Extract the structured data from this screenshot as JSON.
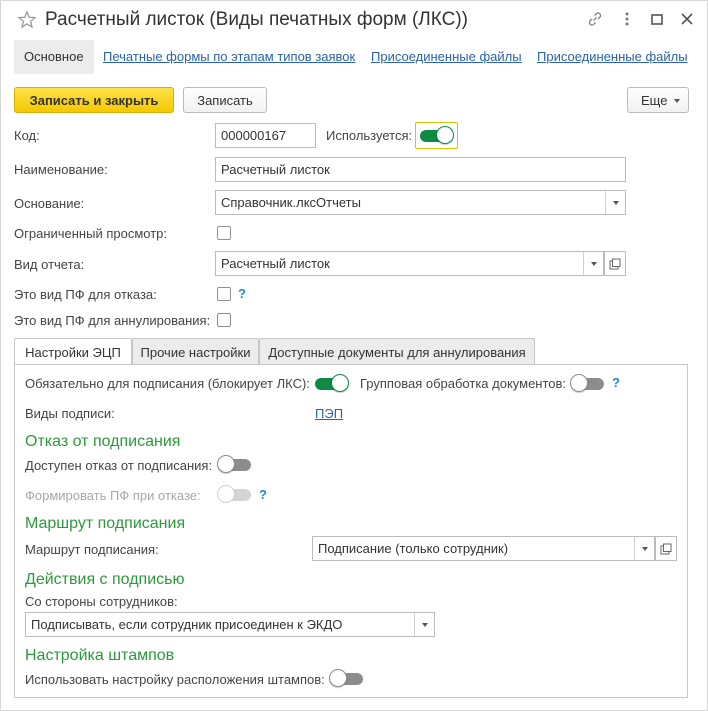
{
  "window": {
    "title": "Расчетный листок (Виды печатных форм (ЛКС))",
    "icons": [
      "star-icon",
      "link-icon",
      "more-icon",
      "maximize-icon",
      "close-icon"
    ]
  },
  "nav_tabs": [
    {
      "label": "Основное"
    },
    {
      "label": "Печатные формы по этапам типов заявок"
    },
    {
      "label": "Присоединенные файлы"
    },
    {
      "label": "Присоединенные файлы"
    }
  ],
  "toolbar": {
    "save_close": "Записать и закрыть",
    "save": "Записать",
    "more": "Еще"
  },
  "form": {
    "code_label": "Код:",
    "code_value": "000000167",
    "used_label": "Используется:",
    "used_on": true,
    "name_label": "Наименование:",
    "name_value": "Расчетный листок",
    "basis_label": "Основание:",
    "basis_value": "Справочник.лксОтчеты",
    "restricted_label": "Ограниченный просмотр:",
    "report_kind_label": "Вид отчета:",
    "report_kind_value": "Расчетный листок",
    "refusal_pf_label": "Это вид ПФ для отказа:",
    "cancel_pf_label": "Это вид ПФ для аннулирования:",
    "help": "?"
  },
  "sub_tabs": [
    {
      "label": "Настройки ЭЦП"
    },
    {
      "label": "Прочие настройки"
    },
    {
      "label": "Доступные документы для аннулирования"
    }
  ],
  "ecp": {
    "required_label": "Обязательно для подписания (блокирует ЛКС):",
    "required_on": true,
    "group_label": "Групповая обработка документов:",
    "group_on": false,
    "sign_kinds_label": "Виды подписи:",
    "sign_kinds_value": "ПЭП",
    "refusal_section": "Отказ от подписания",
    "refusal_available_label": "Доступен отказ от подписания:",
    "form_pf_label": "Формировать ПФ при отказе:",
    "route_section": "Маршрут подписания",
    "route_label": "Маршрут подписания:",
    "route_value": "Подписание (только сотрудник)",
    "actions_section": "Действия с подписью",
    "employee_side_label": "Со стороны сотрудников:",
    "employee_side_value": "Подписывать, если сотрудник присоединен к ЭКДО",
    "stamps_section": "Настройка штампов",
    "stamps_label": "Использовать настройку расположения штампов:"
  },
  "colors": {
    "accent_green": "#0f8a44",
    "section_green": "#2c9a3c",
    "primary_yellow": "#f5c800",
    "link_blue": "#2b63a8"
  }
}
